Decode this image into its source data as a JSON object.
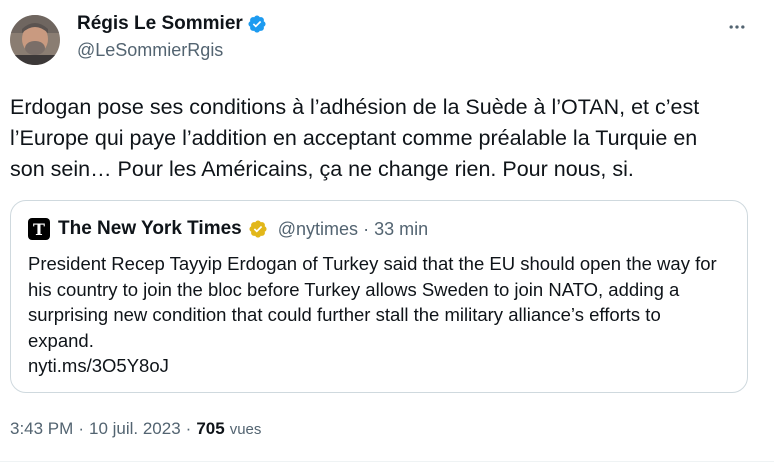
{
  "author": {
    "name": "Régis Le Sommier",
    "handle": "@LeSommierRgis",
    "verified_color": "#1d9bf0"
  },
  "tweet": {
    "text": "Erdogan pose ses conditions à l’adhésion de la Suède à l’OTAN, et c’est\nl’Europe qui paye l’addition en acceptant comme préalable la Turquie en\nson sein… Pour les Américains, ça ne change rien. Pour nous, si."
  },
  "quote": {
    "logo_glyph": "T",
    "name": "The New York Times",
    "verified_color": "#e2b719",
    "handle": "@nytimes",
    "separator": "·",
    "time": "33 min",
    "text": "President Recep Tayyip Erdogan of Turkey said that the EU should open the way for his country to join the bloc before Turkey allows Sweden to join NATO, adding a surprising new condition that could further stall the military alliance’s efforts to expand.",
    "link": "nyti.ms/3O5Y8oJ"
  },
  "footer": {
    "time": "3:43 PM",
    "sep1": "·",
    "date": "10 juil. 2023",
    "sep2": "·",
    "views_count": "705",
    "views_label": "vues"
  },
  "icons": {
    "more": "more-horizontal-icon",
    "verified": "verified-badge-icon",
    "gold_verified": "gold-verified-badge-icon"
  }
}
